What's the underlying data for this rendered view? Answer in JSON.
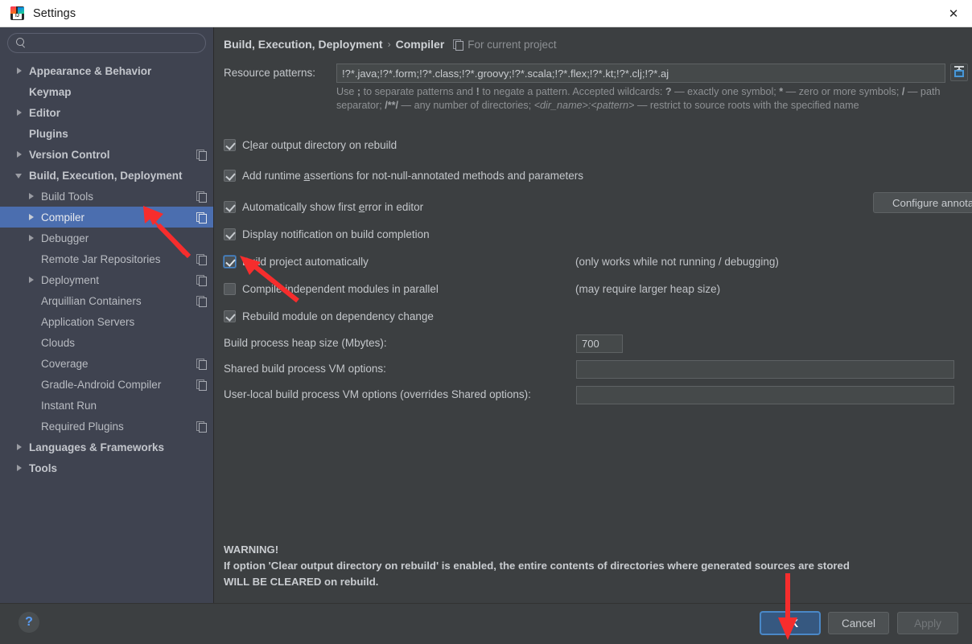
{
  "window": {
    "title": "Settings",
    "logo_icon": "intellij-idea-logo",
    "close_icon": "close-icon"
  },
  "sidebar": {
    "search": {
      "value": "",
      "placeholder": "",
      "icon": "search-icon"
    },
    "items": [
      {
        "label": "Appearance & Behavior",
        "level": 0,
        "arrow": "right",
        "scope_icon": false,
        "selected": false
      },
      {
        "label": "Keymap",
        "level": 0,
        "arrow": "none",
        "scope_icon": false,
        "selected": false
      },
      {
        "label": "Editor",
        "level": 0,
        "arrow": "right",
        "scope_icon": false,
        "selected": false
      },
      {
        "label": "Plugins",
        "level": 0,
        "arrow": "none",
        "scope_icon": false,
        "selected": false
      },
      {
        "label": "Version Control",
        "level": 0,
        "arrow": "right",
        "scope_icon": true,
        "selected": false
      },
      {
        "label": "Build, Execution, Deployment",
        "level": 0,
        "arrow": "down",
        "scope_icon": false,
        "selected": false
      },
      {
        "label": "Build Tools",
        "level": 1,
        "arrow": "right",
        "scope_icon": true,
        "selected": false
      },
      {
        "label": "Compiler",
        "level": 1,
        "arrow": "right",
        "scope_icon": true,
        "selected": true
      },
      {
        "label": "Debugger",
        "level": 1,
        "arrow": "right",
        "scope_icon": false,
        "selected": false
      },
      {
        "label": "Remote Jar Repositories",
        "level": 1,
        "arrow": "none",
        "scope_icon": true,
        "selected": false
      },
      {
        "label": "Deployment",
        "level": 1,
        "arrow": "right",
        "scope_icon": true,
        "selected": false
      },
      {
        "label": "Arquillian Containers",
        "level": 1,
        "arrow": "none",
        "scope_icon": true,
        "selected": false
      },
      {
        "label": "Application Servers",
        "level": 1,
        "arrow": "none",
        "scope_icon": false,
        "selected": false
      },
      {
        "label": "Clouds",
        "level": 1,
        "arrow": "none",
        "scope_icon": false,
        "selected": false
      },
      {
        "label": "Coverage",
        "level": 1,
        "arrow": "none",
        "scope_icon": true,
        "selected": false
      },
      {
        "label": "Gradle-Android Compiler",
        "level": 1,
        "arrow": "none",
        "scope_icon": true,
        "selected": false
      },
      {
        "label": "Instant Run",
        "level": 1,
        "arrow": "none",
        "scope_icon": false,
        "selected": false
      },
      {
        "label": "Required Plugins",
        "level": 1,
        "arrow": "none",
        "scope_icon": true,
        "selected": false
      },
      {
        "label": "Languages & Frameworks",
        "level": 0,
        "arrow": "right",
        "scope_icon": false,
        "selected": false
      },
      {
        "label": "Tools",
        "level": 0,
        "arrow": "right",
        "scope_icon": false,
        "selected": false
      }
    ]
  },
  "content": {
    "breadcrumb": {
      "path": "Build, Execution, Deployment",
      "separator": "›",
      "page": "Compiler",
      "scope_icon": "project-scope-icon",
      "scope_note": "For current project"
    },
    "resource_patterns": {
      "label": "Resource patterns:",
      "value": "!?*.java;!?*.form;!?*.class;!?*.groovy;!?*.scala;!?*.flex;!?*.kt;!?*.clj;!?*.aj",
      "expand_button_icon": "expand-editor-icon",
      "hint": {
        "p1": "Use ",
        "b1": ";",
        "p2": " to separate patterns and ",
        "b2": "!",
        "p3": " to negate a pattern. Accepted wildcards: ",
        "b3": "?",
        "p4": " — exactly one symbol; ",
        "b4": "*",
        "p5": " — zero or more symbols; ",
        "b5": "/",
        "p6": " — path separator; ",
        "b6": "/**/",
        "p7": " — any number of directories; ",
        "i1": "<dir_name>:<pattern>",
        "p8": " — restrict to source roots with the specified name"
      }
    },
    "checkboxes": [
      {
        "label_pre": "C",
        "label_mn": "l",
        "label_post": "ear output directory on rebuild",
        "checked": true,
        "focused": false,
        "note": ""
      },
      {
        "label_pre": "Add runtime ",
        "label_mn": "a",
        "label_post": "ssertions for not-null-annotated methods and parameters",
        "checked": true,
        "focused": false,
        "note": ""
      },
      {
        "label_pre": "Automatically show first ",
        "label_mn": "e",
        "label_post": "rror in editor",
        "checked": true,
        "focused": false,
        "note": ""
      },
      {
        "label_pre": "Display notification on build completion",
        "label_mn": "",
        "label_post": "",
        "checked": true,
        "focused": false,
        "note": ""
      },
      {
        "label_pre": "Build project automatically",
        "label_mn": "",
        "label_post": "",
        "checked": true,
        "focused": true,
        "note": "(only works while not running / debugging)"
      },
      {
        "label_pre": "Compile independent modules in parallel",
        "label_mn": "",
        "label_post": "",
        "checked": false,
        "focused": false,
        "note": "(may require larger heap size)"
      },
      {
        "label_pre": "Rebuild module on dependency change",
        "label_mn": "",
        "label_post": "",
        "checked": true,
        "focused": false,
        "note": ""
      }
    ],
    "configure_annotations_button": "Configure annotations...",
    "fields": [
      {
        "label": "Build process heap size (Mbytes):",
        "value": "700",
        "wide": false
      },
      {
        "label": "Shared build process VM options:",
        "value": "",
        "wide": true
      },
      {
        "label": "User-local build process VM options (overrides Shared options):",
        "value": "",
        "wide": true
      }
    ],
    "warning": {
      "line1": "WARNING!",
      "line2": "If option 'Clear output directory on rebuild' is enabled, the entire contents of directories where generated sources are stored",
      "line3": "WILL BE CLEARED on rebuild."
    }
  },
  "footer": {
    "help_label": "?",
    "ok_label": "OK",
    "cancel_label": "Cancel",
    "apply_label": "Apply"
  },
  "annotations": {
    "arrow_color": "#f62d2d",
    "arrow_compiler": "points-at-compiler-tree-item",
    "arrow_build_auto": "points-at-build-project-automatically-checkbox",
    "arrow_ok": "points-at-ok-button"
  },
  "colors": {
    "selection": "#4b6eaf",
    "panel_bg": "#3c3f41",
    "sidebar_bg": "#3f4350",
    "primary_button": "#365880",
    "accent_blue": "#589df6"
  }
}
